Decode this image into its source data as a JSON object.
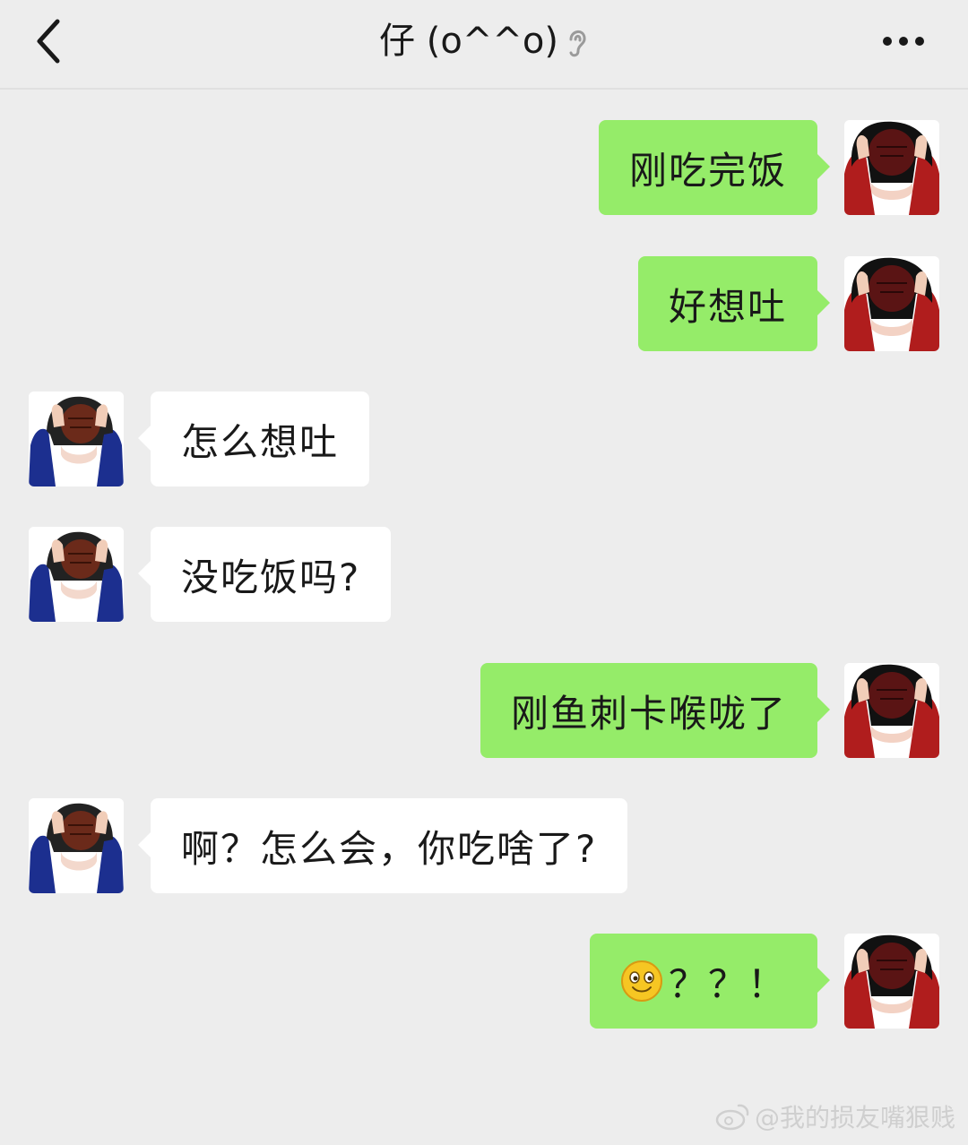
{
  "header": {
    "title": "仔 (o^^o)",
    "back_icon": "chevron-left-icon",
    "ear_icon": "ear-icon",
    "more_icon": "more-dots-icon"
  },
  "messages": [
    {
      "side": "right",
      "text": "刚吃完饭"
    },
    {
      "side": "right",
      "text": "好想吐"
    },
    {
      "side": "left",
      "text": "怎么想吐"
    },
    {
      "side": "left",
      "text": "没吃饭吗?"
    },
    {
      "side": "right",
      "text": "刚鱼刺卡喉咙了"
    },
    {
      "side": "left",
      "text": "啊？怎么会，你吃啥了?"
    },
    {
      "side": "right",
      "emoji": "smiley-icon",
      "text": "？？！"
    }
  ],
  "colors": {
    "background": "#ededed",
    "sent_bubble": "#95ec69",
    "received_bubble": "#ffffff"
  },
  "watermark": "@我的损友嘴狠贱"
}
